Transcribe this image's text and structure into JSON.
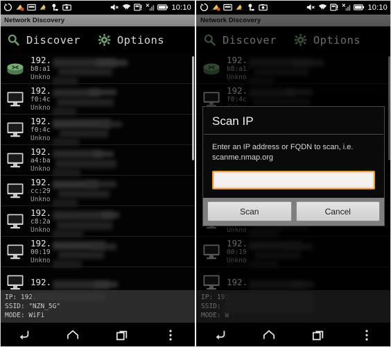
{
  "statusbar": {
    "icons_left": [
      "sync-icon",
      "download-alert-icon",
      "sd-card-icon",
      "download-icon",
      "usb-debug-icon",
      "screenshot-icon"
    ],
    "icons_right": [
      "volume-mute-icon",
      "wifi-icon",
      "sd-warning-icon",
      "signal-no-service-icon",
      "battery-icon"
    ],
    "clock": "10:10"
  },
  "app": {
    "title": "Network Discovery"
  },
  "toolbar": {
    "discover_label": "Discover",
    "discover_icon": "search-icon",
    "options_label": "Options",
    "options_icon": "gear-icon"
  },
  "devices": [
    {
      "icon": "router-icon",
      "ip": "192.",
      "mac": "b8:a1",
      "vendor": "Unkno"
    },
    {
      "icon": "computer-icon",
      "ip": "192.",
      "mac": "f0:4c",
      "vendor": "Unkno"
    },
    {
      "icon": "computer-icon",
      "ip": "192.",
      "mac": "f0:4c",
      "vendor": "Unkno"
    },
    {
      "icon": "computer-icon",
      "ip": "192.",
      "mac": "a4:ba",
      "vendor": "Unkno"
    },
    {
      "icon": "computer-icon",
      "ip": "192.",
      "mac": "cc:29",
      "vendor": "Unkno"
    },
    {
      "icon": "computer-icon",
      "ip": "192.",
      "mac": "c8:2a",
      "vendor": "Unkno"
    },
    {
      "icon": "computer-icon",
      "ip": "192.",
      "mac": "00:19",
      "vendor": "Unkno"
    },
    {
      "icon": "computer-icon",
      "ip": "192.",
      "mac": "",
      "vendor": ""
    }
  ],
  "infobar": {
    "ip_line": "IP: 192.",
    "ssid_line": "SSID: \"NZN_5G\"",
    "mode_line": "MODE: WiFi",
    "ip_line_right": "IP: 192",
    "ssid_line_right": "SSID: \"",
    "mode_line_right": "MODE: W"
  },
  "navbar": {
    "back": "back-icon",
    "home": "home-icon",
    "recents": "recent-apps-icon",
    "menu": "overflow-menu-icon"
  },
  "dialog": {
    "title": "Scan IP",
    "message": "Enter an IP address or FQDN to scan, i.e. scanme.nmap.org",
    "input_value": "",
    "input_placeholder": "",
    "scan_label": "Scan",
    "cancel_label": "Cancel"
  },
  "colors": {
    "accent_green": "#6f9d6f",
    "input_border": "#e59a3c",
    "titlebar": "#8f8f8f",
    "background": "#000000"
  }
}
